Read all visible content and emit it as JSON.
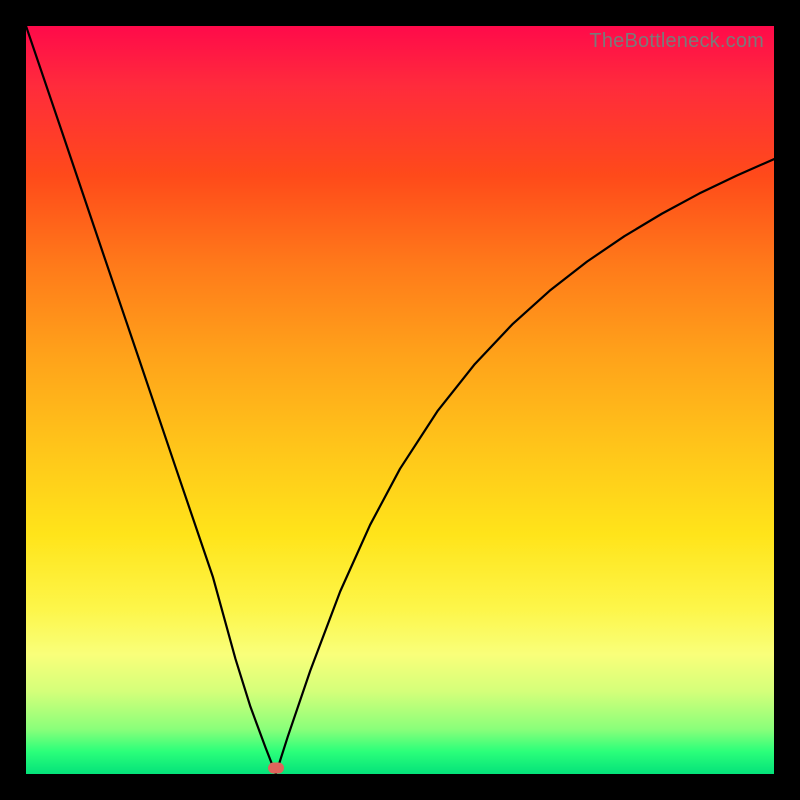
{
  "watermark": "TheBottleneck.com",
  "colors": {
    "frame": "#000000",
    "curve": "#000000",
    "marker": "#e0645c"
  },
  "chart_data": {
    "type": "line",
    "title": "",
    "xlabel": "",
    "ylabel": "",
    "xlim": [
      0,
      100
    ],
    "ylim": [
      0,
      100
    ],
    "grid": false,
    "legend": false,
    "series": [
      {
        "name": "curve",
        "x": [
          0,
          5,
          10,
          15,
          20,
          25,
          28,
          30,
          32,
          33.4,
          35,
          38,
          42,
          46,
          50,
          55,
          60,
          65,
          70,
          75,
          80,
          85,
          90,
          95,
          100
        ],
        "values": [
          100,
          85.3,
          70.5,
          55.8,
          41.0,
          26.3,
          15.4,
          9.0,
          3.6,
          0.0,
          5.0,
          13.8,
          24.4,
          33.3,
          40.8,
          48.5,
          54.8,
          60.1,
          64.6,
          68.5,
          71.9,
          74.9,
          77.6,
          80.0,
          82.2
        ]
      }
    ],
    "marker": {
      "x": 33.4,
      "y": 0.8
    }
  }
}
